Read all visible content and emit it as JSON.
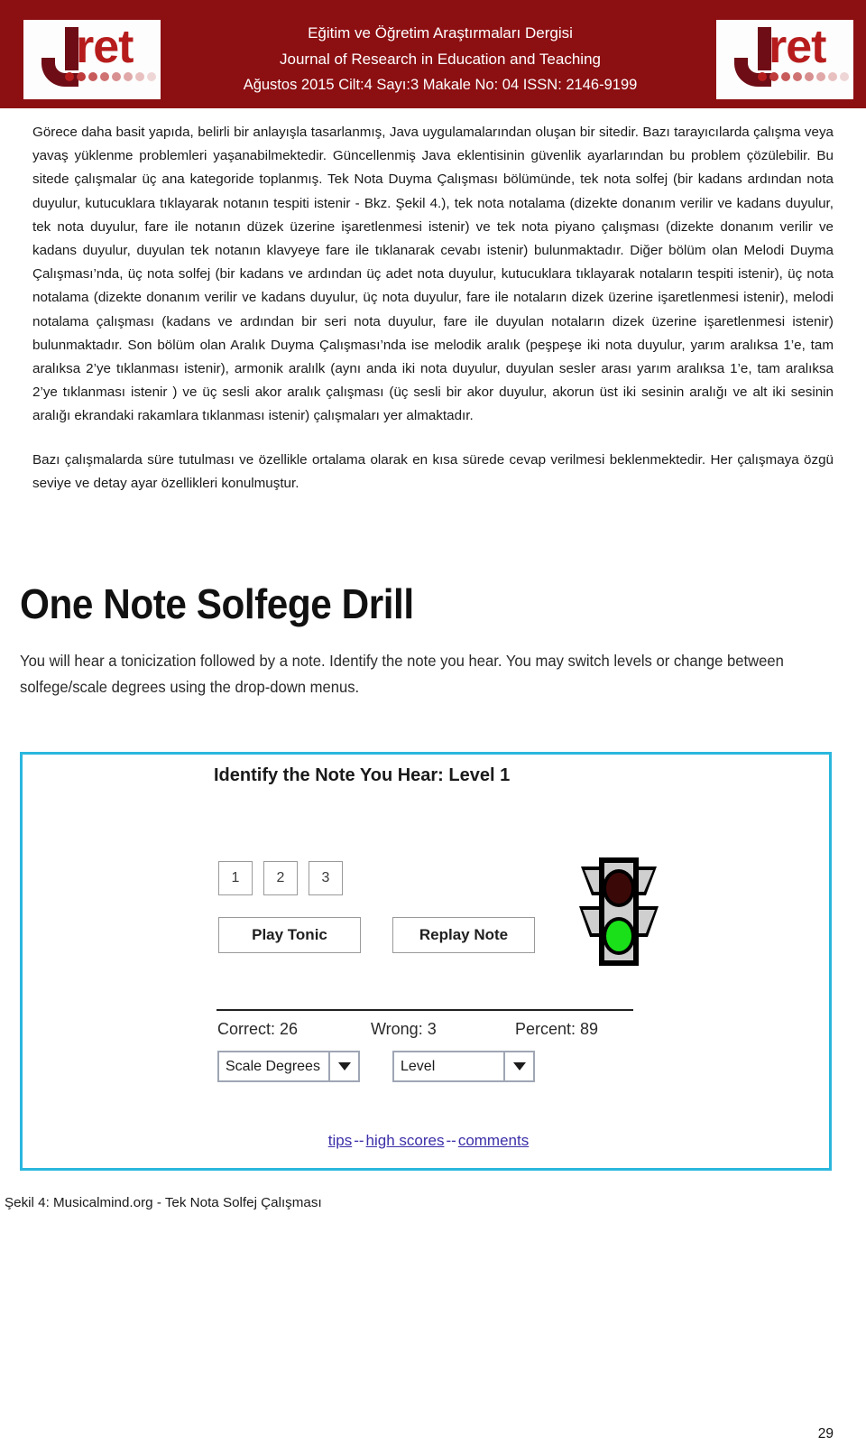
{
  "header": {
    "logo_letter": "J",
    "logo_word": "ret",
    "title_tr": "Eğitim ve Öğretim Araştırmaları Dergisi",
    "title_en": "Journal of Research in Education and Teaching",
    "issue_line": "Ağustos 2015  Cilt:4  Sayı:3  Makale No: 04   ISSN: 2146-9199",
    "background_color": "#8c0f12",
    "logo_red": "#b71c1c",
    "logo_dark_red": "#6e0d16"
  },
  "document": {
    "paragraph_1": "Görece daha basit yapıda, belirli bir anlayışla tasarlanmış, Java uygulamalarından oluşan bir sitedir. Bazı tarayıcılarda çalışma veya yavaş yüklenme problemleri yaşanabilmektedir. Güncellenmiş Java eklentisinin güvenlik ayarlarından bu problem çözülebilir. Bu sitede çalışmalar üç ana kategoride toplanmış. Tek Nota Duyma Çalışması bölümünde, tek nota solfej (bir kadans ardından nota duyulur, kutucuklara tıklayarak notanın tespiti istenir - Bkz. Şekil 4.), tek nota notalama (dizekte donanım verilir ve kadans duyulur, tek nota duyulur, fare ile notanın düzek üzerine işaretlenmesi istenir) ve tek nota piyano çalışması (dizekte donanım verilir ve kadans duyulur, duyulan tek notanın klavyeye fare ile tıklanarak cevabı istenir) bulunmaktadır. Diğer bölüm olan Melodi Duyma Çalışması’nda, üç nota solfej (bir kadans ve ardından üç adet nota duyulur, kutucuklara tıklayarak notaların tespiti istenir), üç nota notalama (dizekte donanım verilir ve kadans duyulur, üç nota duyulur, fare ile notaların dizek üzerine işaretlenmesi istenir), melodi notalama çalışması (kadans ve ardından bir seri nota duyulur, fare ile duyulan notaların dizek üzerine işaretlenmesi istenir) bulunmaktadır. Son bölüm olan Aralık Duyma Çalışması’nda ise melodik aralık (peşpeşe iki nota duyulur, yarım aralıksa 1’e, tam aralıksa 2’ye tıklanması istenir), armonik aralılk (aynı anda iki nota duyulur, duyulan sesler arası yarım aralıksa 1’e, tam aralıksa 2’ye tıklanması istenir ) ve üç sesli akor aralık çalışması (üç sesli bir akor duyulur, akorun üst iki sesinin aralığı ve alt iki sesinin aralığı ekrandaki rakamlara tıklanması istenir) çalışmaları yer almaktadır.",
    "paragraph_2": "Bazı çalışmalarda süre tutulması ve özellikle ortalama olarak en kısa sürede cevap verilmesi beklenmektedir. Her çalışmaya özgü seviye ve detay ayar özellikleri konulmuştur.",
    "figure_caption": "Şekil 4: Musicalmind.org - Tek Nota Solfej Çalışması",
    "page_number": "29"
  },
  "applet": {
    "app_title": "One Note Solfege Drill",
    "app_description": "You will hear a tonicization followed by a note. Identify the note you hear. You may switch levels or change between solfege/scale degrees using the drop-down menus.",
    "panel_border_color": "#2ab7dd",
    "heading": "Identify the Note You Hear: Level 1",
    "note_buttons": [
      "1",
      "2",
      "3"
    ],
    "play_tonic_label": "Play Tonic",
    "replay_note_label": "Replay Note",
    "traffic_light": {
      "top_lamp_color": "#3b0808",
      "bottom_lamp_color": "#19e019",
      "body_color": "#000000",
      "housing_color": "#d4d4d4",
      "state": "green"
    },
    "stats": {
      "correct": "Correct: 26",
      "wrong": "Wrong: 3",
      "percent": "Percent: 89"
    },
    "selects": [
      {
        "name": "scale-degrees",
        "value": "Scale Degrees"
      },
      {
        "name": "level",
        "value": "Level"
      }
    ],
    "footer_links": {
      "tips": "tips",
      "separator": "--",
      "high_scores": "high scores",
      "comments": "comments",
      "link_color": "#3b2fa8"
    }
  }
}
